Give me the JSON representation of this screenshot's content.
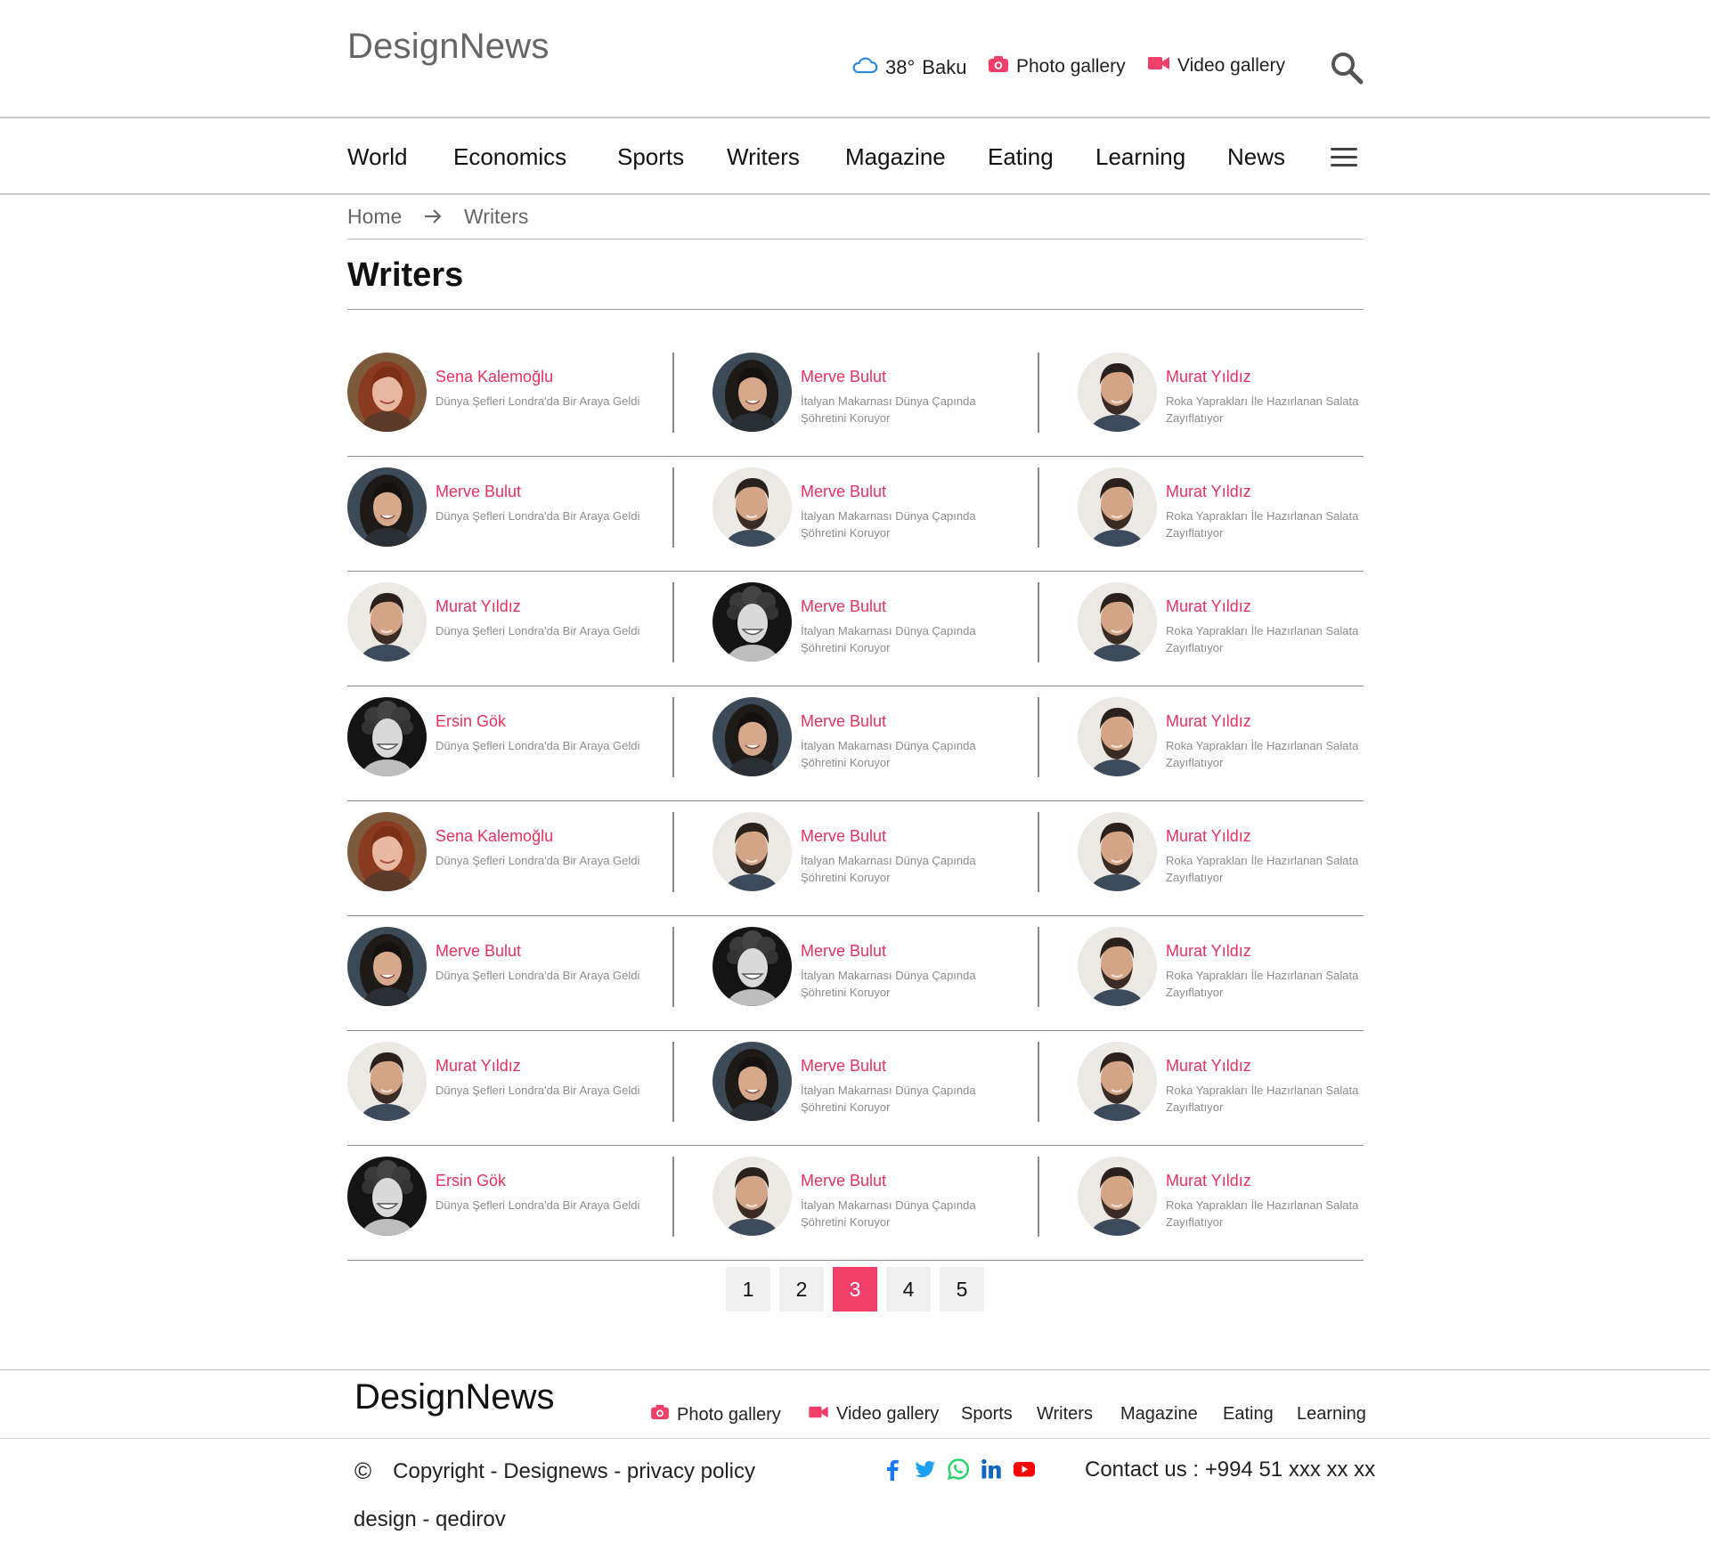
{
  "header": {
    "logo": "DesignNews",
    "weather": {
      "temp": "38°",
      "city": "Baku",
      "icon": "cloud-icon",
      "icon_color": "#2f8bd8"
    },
    "photo_gallery": "Photo gallery",
    "video_gallery": "Video gallery",
    "accent_color": "#f03f6a"
  },
  "nav": {
    "items": [
      "World",
      "Economics",
      "Sports",
      "Writers",
      "Magazine",
      "Eating",
      "Learning",
      "News"
    ]
  },
  "breadcrumb": {
    "home": "Home",
    "current": "Writers"
  },
  "page_title": "Writers",
  "writers": [
    [
      {
        "name": "Sena Kalemoğlu",
        "headline": "Dünya Şefleri Londra'da Bir Araya Geldi",
        "avatar": "woman-red-hair"
      },
      {
        "name": "Merve Bulut",
        "headline": "İtalyan Makarnası Dünya Çapında Şöhretini Koruyor",
        "avatar": "woman-dark-hair"
      },
      {
        "name": "Murat Yıldız",
        "headline": "Roka Yaprakları İle Hazırlanan Salata Zayıflatıyor",
        "avatar": "man-beard"
      }
    ],
    [
      {
        "name": "Merve Bulut",
        "headline": "Dünya Şefleri Londra'da Bir Araya Geldi",
        "avatar": "woman-dark-hair"
      },
      {
        "name": "Merve Bulut",
        "headline": "İtalyan Makarnası Dünya Çapında Şöhretini Koruyor",
        "avatar": "man-beard"
      },
      {
        "name": "Murat Yıldız",
        "headline": "Roka Yaprakları İle Hazırlanan Salata Zayıflatıyor",
        "avatar": "man-beard"
      }
    ],
    [
      {
        "name": "Murat Yıldız",
        "headline": "Dünya Şefleri Londra'da Bir Araya Geldi",
        "avatar": "man-beard"
      },
      {
        "name": "Merve Bulut",
        "headline": "İtalyan Makarnası Dünya Çapında Şöhretini Koruyor",
        "avatar": "man-curly"
      },
      {
        "name": "Murat Yıldız",
        "headline": "Roka Yaprakları İle Hazırlanan Salata Zayıflatıyor",
        "avatar": "man-beard"
      }
    ],
    [
      {
        "name": "Ersin Gök",
        "headline": "Dünya Şefleri Londra'da Bir Araya Geldi",
        "avatar": "man-curly"
      },
      {
        "name": "Merve Bulut",
        "headline": "İtalyan Makarnası Dünya Çapında Şöhretini Koruyor",
        "avatar": "woman-dark-hair"
      },
      {
        "name": "Murat Yıldız",
        "headline": "Roka Yaprakları İle Hazırlanan Salata Zayıflatıyor",
        "avatar": "man-beard"
      }
    ],
    [
      {
        "name": "Sena Kalemoğlu",
        "headline": "Dünya Şefleri Londra'da Bir Araya Geldi",
        "avatar": "woman-red-hair"
      },
      {
        "name": "Merve Bulut",
        "headline": "İtalyan Makarnası Dünya Çapında Şöhretini Koruyor",
        "avatar": "man-beard"
      },
      {
        "name": "Murat Yıldız",
        "headline": "Roka Yaprakları İle Hazırlanan Salata Zayıflatıyor",
        "avatar": "man-beard"
      }
    ],
    [
      {
        "name": "Merve Bulut",
        "headline": "Dünya Şefleri Londra'da Bir Araya Geldi",
        "avatar": "woman-dark-hair"
      },
      {
        "name": "Merve Bulut",
        "headline": "İtalyan Makarnası Dünya Çapında Şöhretini Koruyor",
        "avatar": "man-curly"
      },
      {
        "name": "Murat Yıldız",
        "headline": "Roka Yaprakları İle Hazırlanan Salata Zayıflatıyor",
        "avatar": "man-beard"
      }
    ],
    [
      {
        "name": "Murat Yıldız",
        "headline": "Dünya Şefleri Londra'da Bir Araya Geldi",
        "avatar": "man-beard"
      },
      {
        "name": "Merve Bulut",
        "headline": "İtalyan Makarnası Dünya Çapında Şöhretini Koruyor",
        "avatar": "woman-dark-hair"
      },
      {
        "name": "Murat Yıldız",
        "headline": "Roka Yaprakları İle Hazırlanan Salata Zayıflatıyor",
        "avatar": "man-beard"
      }
    ],
    [
      {
        "name": "Ersin Gök",
        "headline": "Dünya Şefleri Londra'da Bir Araya Geldi",
        "avatar": "man-curly"
      },
      {
        "name": "Merve Bulut",
        "headline": "İtalyan Makarnası Dünya Çapında Şöhretini Koruyor",
        "avatar": "man-beard"
      },
      {
        "name": "Murat Yıldız",
        "headline": "Roka Yaprakları İle Hazırlanan Salata Zayıflatıyor",
        "avatar": "man-beard"
      }
    ]
  ],
  "pagination": {
    "pages": [
      "1",
      "2",
      "3",
      "4",
      "5"
    ],
    "current": "3"
  },
  "footer": {
    "logo": "DesignNews",
    "photo_gallery": "Photo gallery",
    "video_gallery": "Video gallery",
    "links": [
      "Sports",
      "Writers",
      "Magazine",
      "Eating",
      "Learning"
    ],
    "copyright_symbol": "©",
    "copyright": "Copyright - Designews - privacy policy",
    "credit": "design - qedirov",
    "contact": "Contact us : +994 51 xxx xx xx",
    "socials": [
      {
        "icon": "facebook-icon",
        "color": "#1877f2"
      },
      {
        "icon": "twitter-icon",
        "color": "#1da1f2"
      },
      {
        "icon": "whatsapp-icon",
        "color": "#25d366"
      },
      {
        "icon": "linkedin-icon",
        "color": "#0a66c2"
      },
      {
        "icon": "youtube-icon",
        "color": "#ff0000"
      }
    ]
  }
}
